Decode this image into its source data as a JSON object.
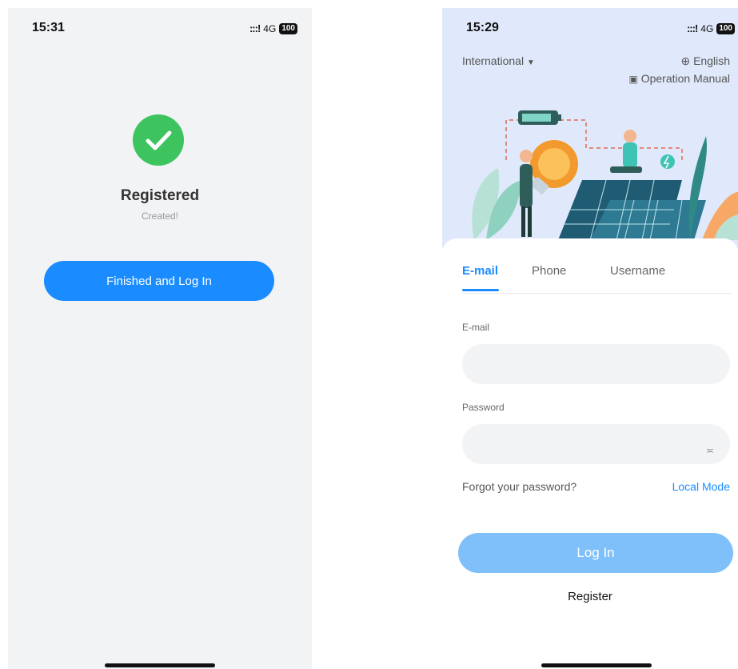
{
  "left_screen": {
    "status": {
      "time": "15:31",
      "signal": ":::!",
      "network": "4G",
      "battery": "100"
    },
    "success_icon": "check-circle-icon",
    "title": "Registered",
    "subtitle": "Created!",
    "finish_button": "Finished and Log In",
    "colors": {
      "background": "#f2f3f5",
      "success": "#3dc45f",
      "primary": "#1a8cff"
    }
  },
  "right_screen": {
    "status": {
      "time": "15:29",
      "signal": ":::!",
      "network": "4G",
      "battery": "100"
    },
    "header": {
      "region": "International",
      "language": "English",
      "manual": "Operation Manual"
    },
    "tabs": [
      {
        "label": "E-mail",
        "active": true
      },
      {
        "label": "Phone",
        "active": false
      },
      {
        "label": "Username",
        "active": false
      }
    ],
    "email": {
      "label": "E-mail",
      "value": "",
      "placeholder": ""
    },
    "password": {
      "label": "Password",
      "value": "",
      "placeholder": ""
    },
    "forgot_password": "Forgot your password?",
    "local_mode": "Local Mode",
    "login_button": "Log In",
    "register": "Register",
    "colors": {
      "hero": "#dfe9fb",
      "primary": "#1a8cff",
      "login_disabled": "#7fc0fb"
    }
  }
}
